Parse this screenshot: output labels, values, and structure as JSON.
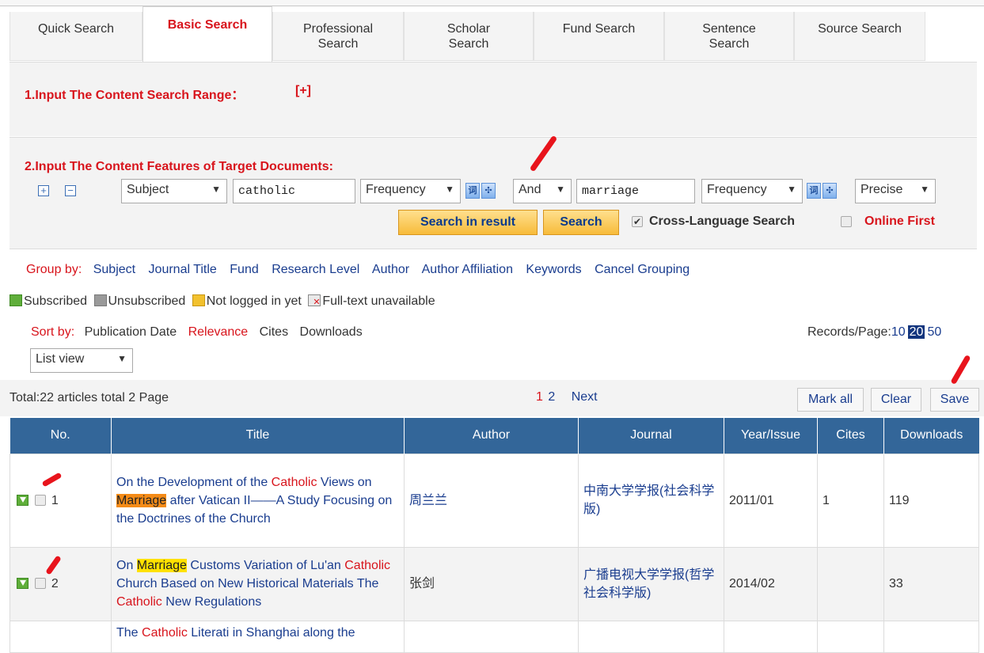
{
  "tabs": [
    "Quick Search",
    "Basic Search",
    "Professional Search",
    "Scholar Search",
    "Fund Search",
    "Sentence Search",
    "Source Search"
  ],
  "active_tab": "Basic Search",
  "range_panel": {
    "heading": "1.Input The Content Search Range：",
    "expand": "[+]"
  },
  "feature_panel": {
    "heading": "2.Input The Content Features of Target Documents:",
    "add": "+",
    "remove": "−",
    "field1": "Subject",
    "term1": "catholic",
    "freq1": "Frequency",
    "logic": "And",
    "term2": "marriage",
    "freq2": "Frequency",
    "match": "Precise",
    "btn_search_in_result": "Search in result",
    "btn_search": "Search",
    "cross_language": "Cross-Language Search",
    "online_first": "Online First"
  },
  "group_by": {
    "label": "Group by:",
    "items": [
      "Subject",
      "Journal Title",
      "Fund",
      "Research Level",
      "Author",
      "Author Affiliation",
      "Keywords",
      "Cancel Grouping"
    ]
  },
  "legend": [
    "Subscribed",
    "Unsubscribed",
    "Not logged in yet",
    "Full-text unavailable"
  ],
  "sort_by": {
    "label": "Sort by:",
    "items": [
      "Publication Date",
      "Relevance",
      "Cites",
      "Downloads"
    ],
    "active": "Relevance"
  },
  "records_per_page": {
    "label": "Records/Page:",
    "options": [
      "10",
      "20",
      "50"
    ],
    "selected": "20"
  },
  "view_mode": "List view",
  "summary": "Total:22 articles  total 2 Page",
  "pages": {
    "current": "1",
    "other": "2",
    "next": "Next"
  },
  "actions": {
    "mark_all": "Mark all",
    "clear": "Clear",
    "save": "Save"
  },
  "table": {
    "headers": [
      "No.",
      "Title",
      "Author",
      "Journal",
      "Year/Issue",
      "Cites",
      "Downloads"
    ],
    "rows": [
      {
        "no": "1",
        "title_parts": [
          "On the Development of the ",
          "Catholic",
          " Views on ",
          "Marriage",
          " after Vatican II——A Study Focusing on the Doctrines of the Church"
        ],
        "author": "周兰兰",
        "journal": "中南大学学报(社会科学版)",
        "year_issue": "2011/01",
        "cites": "1",
        "downloads": "119"
      },
      {
        "no": "2",
        "title_parts": [
          "On ",
          "Marriage",
          " Customs Variation of Lu'an ",
          "Catholic",
          " Church Based on New Historical Materials The ",
          "Catholic",
          " New Regulations"
        ],
        "author": "张剑",
        "journal": "广播电视大学学报(哲学社会科学版)",
        "year_issue": "2014/02",
        "cites": "",
        "downloads": "33"
      },
      {
        "no": "",
        "title_parts": [
          "The ",
          "Catholic",
          " Literati in Shanghai along the"
        ],
        "author": "",
        "journal": "",
        "year_issue": "",
        "cites": "",
        "downloads": ""
      }
    ]
  },
  "colors": {
    "accent_red": "#d8141c",
    "link_blue": "#1a3d8f",
    "header_blue": "#336699",
    "button_orange": "#f7bb3a"
  }
}
